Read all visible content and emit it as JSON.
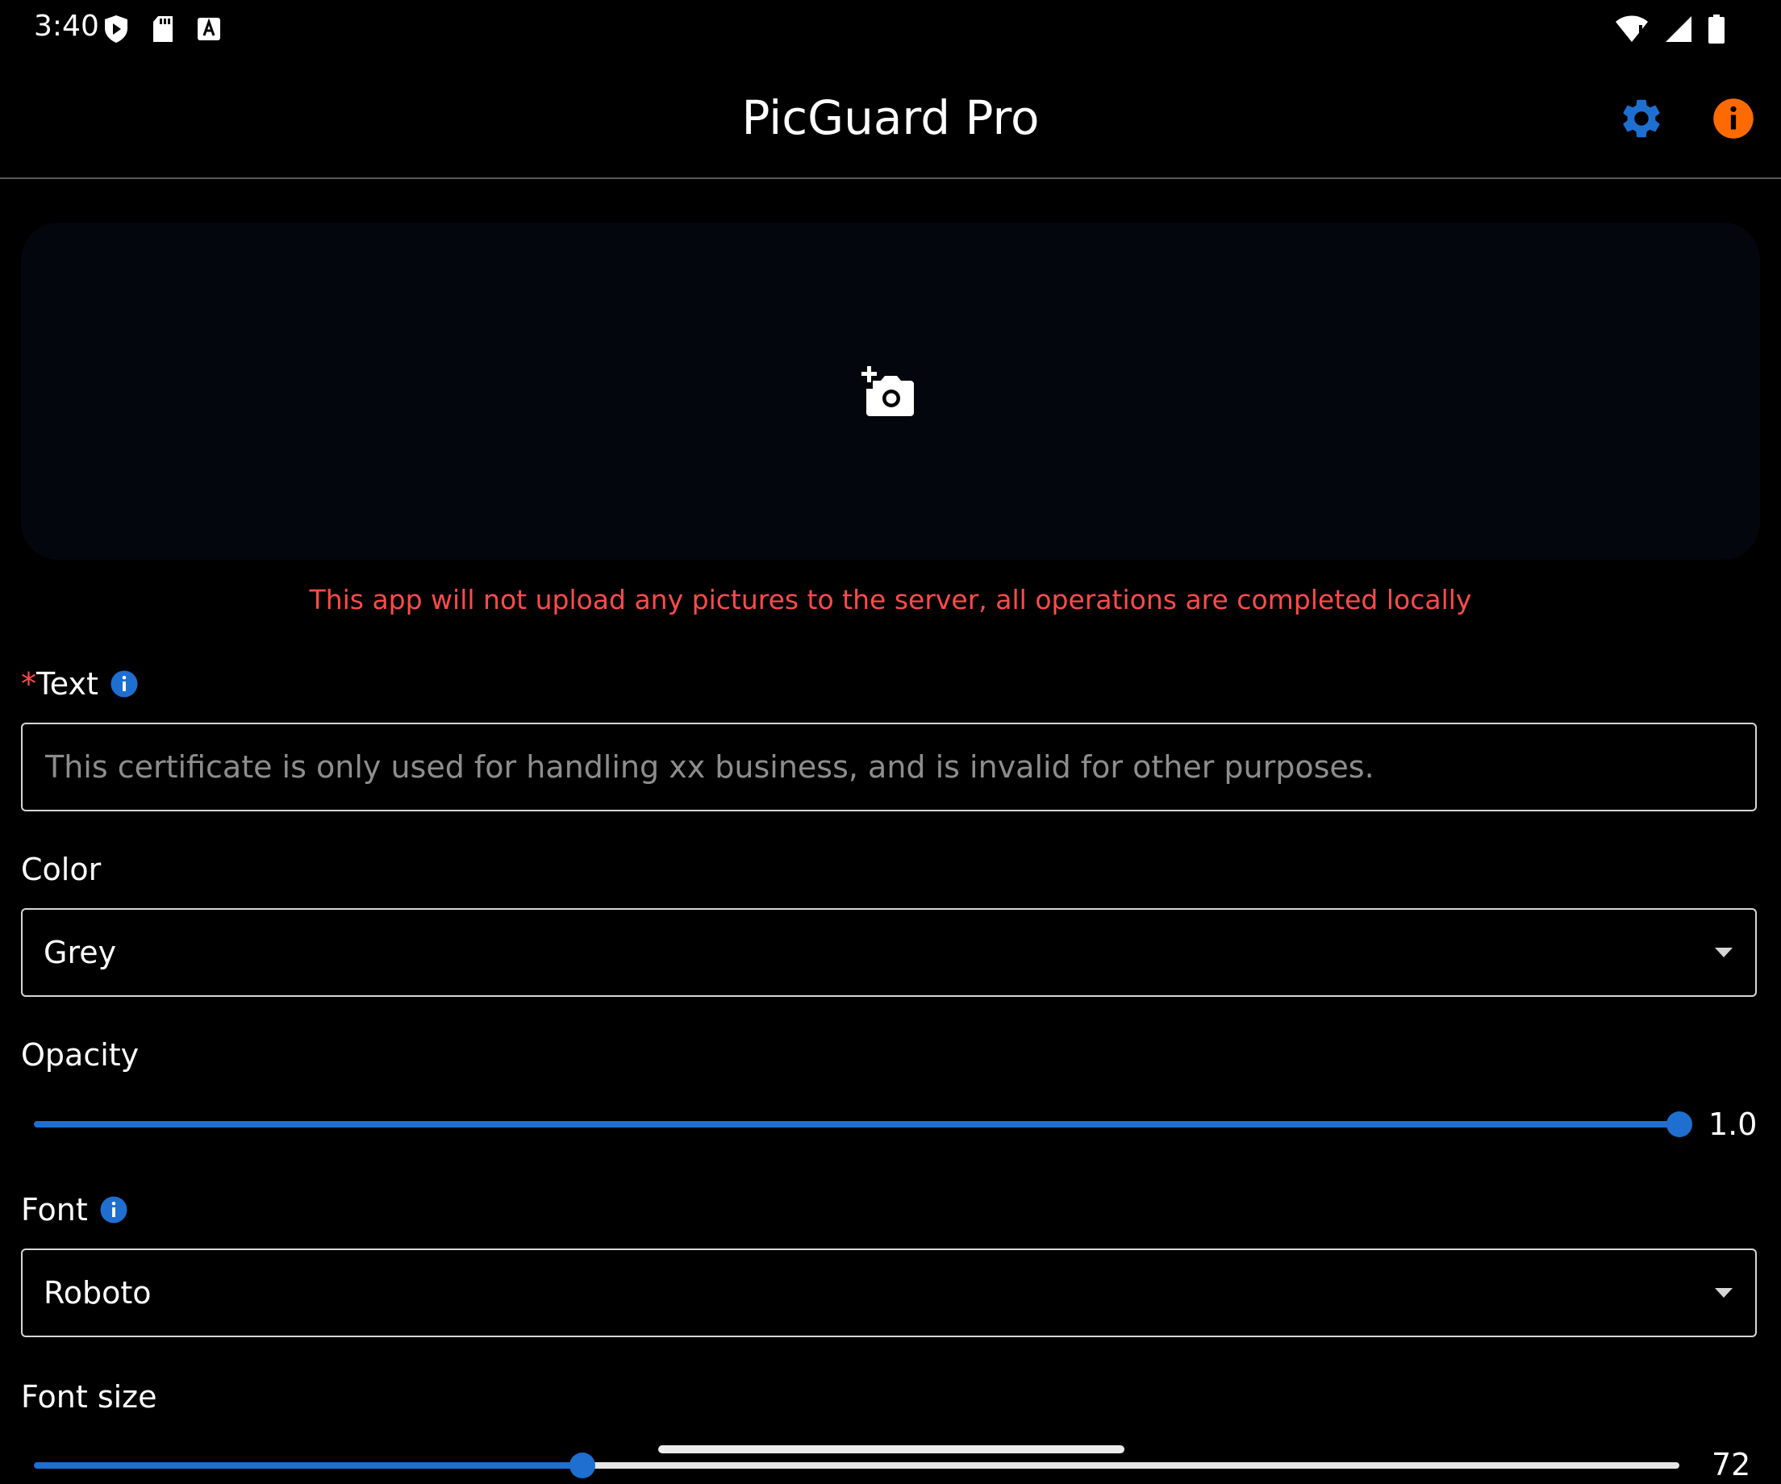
{
  "status_bar": {
    "time": "3:40",
    "left_icons": [
      "shield-play-icon",
      "sd-card-icon",
      "font-a-icon"
    ],
    "right_icons": [
      "wifi-alert-icon",
      "cell-signal-icon",
      "battery-icon"
    ]
  },
  "app_bar": {
    "title": "PicGuard Pro",
    "settings_icon": "gear-icon",
    "info_icon": "info-icon",
    "settings_color": "#1e6fd0",
    "info_color": "#ff6a00"
  },
  "image_picker": {
    "icon": "add-photo-icon"
  },
  "notice": "This app will not upload any pictures to the server, all operations are completed locally",
  "form": {
    "text": {
      "required_mark": "*",
      "label": "Text",
      "placeholder": "This certificate is only used for handling xx business, and is invalid for other purposes.",
      "value": ""
    },
    "color": {
      "label": "Color",
      "selected": "Grey"
    },
    "opacity": {
      "label": "Opacity",
      "value_text": "1.0",
      "value": 1.0,
      "min": 0,
      "max": 1
    },
    "font": {
      "label": "Font",
      "selected": "Roboto"
    },
    "font_size": {
      "label": "Font size",
      "value_text": "72",
      "fraction": 0.33
    }
  },
  "colors": {
    "accent": "#1e6fd0",
    "warning": "#ff4b4b",
    "info_orange": "#ff6a00"
  }
}
